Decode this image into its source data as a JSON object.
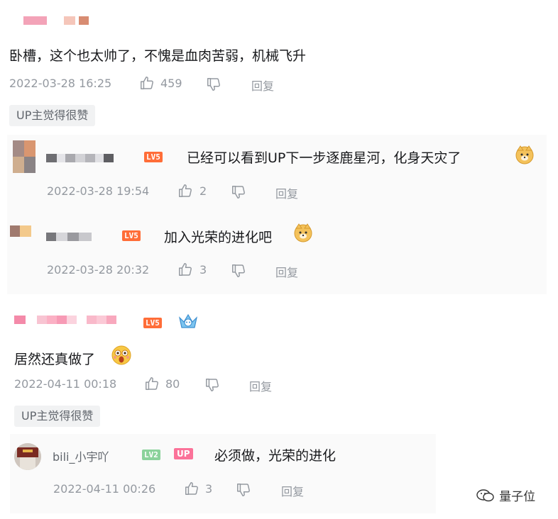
{
  "comments": [
    {
      "text": "卧槽，这个也太帅了，不愧是血肉苦弱，机械飞升",
      "time": "2022-03-28 16:25",
      "likes": "459",
      "reply_label": "回复",
      "up_liked": "UP主觉得很赞",
      "replies": [
        {
          "level": "LV5",
          "text": "已经可以看到UP下一步逐鹿星河，化身天灾了",
          "time": "2022-03-28 19:54",
          "likes": "2",
          "reply_label": "回复"
        },
        {
          "level": "LV5",
          "text": "加入光荣的进化吧",
          "time": "2022-03-28 20:32",
          "likes": "3",
          "reply_label": "回复"
        }
      ]
    },
    {
      "level": "LV5",
      "text": "居然还真做了",
      "time": "2022-04-11 00:18",
      "likes": "80",
      "reply_label": "回复",
      "up_liked": "UP主觉得很赞",
      "replies": [
        {
          "username": "bili_小宇吖",
          "level": "LV2",
          "badge": "UP",
          "text": "必须做，光荣的进化",
          "time": "2022-04-11 00:26",
          "likes": "3",
          "reply_label": "回复"
        }
      ]
    }
  ],
  "watermark": "量子位",
  "colors": {
    "level_orange": "#ff6d38",
    "level_green": "#8bd29b",
    "up_badge": "#fb7299",
    "meta_grey": "#9499a0"
  },
  "icons": [
    "thumbs-up-icon",
    "thumbs-down-icon",
    "doge-emoji",
    "surprised-emoji",
    "crown-badge-icon",
    "wechat-logo-icon"
  ]
}
